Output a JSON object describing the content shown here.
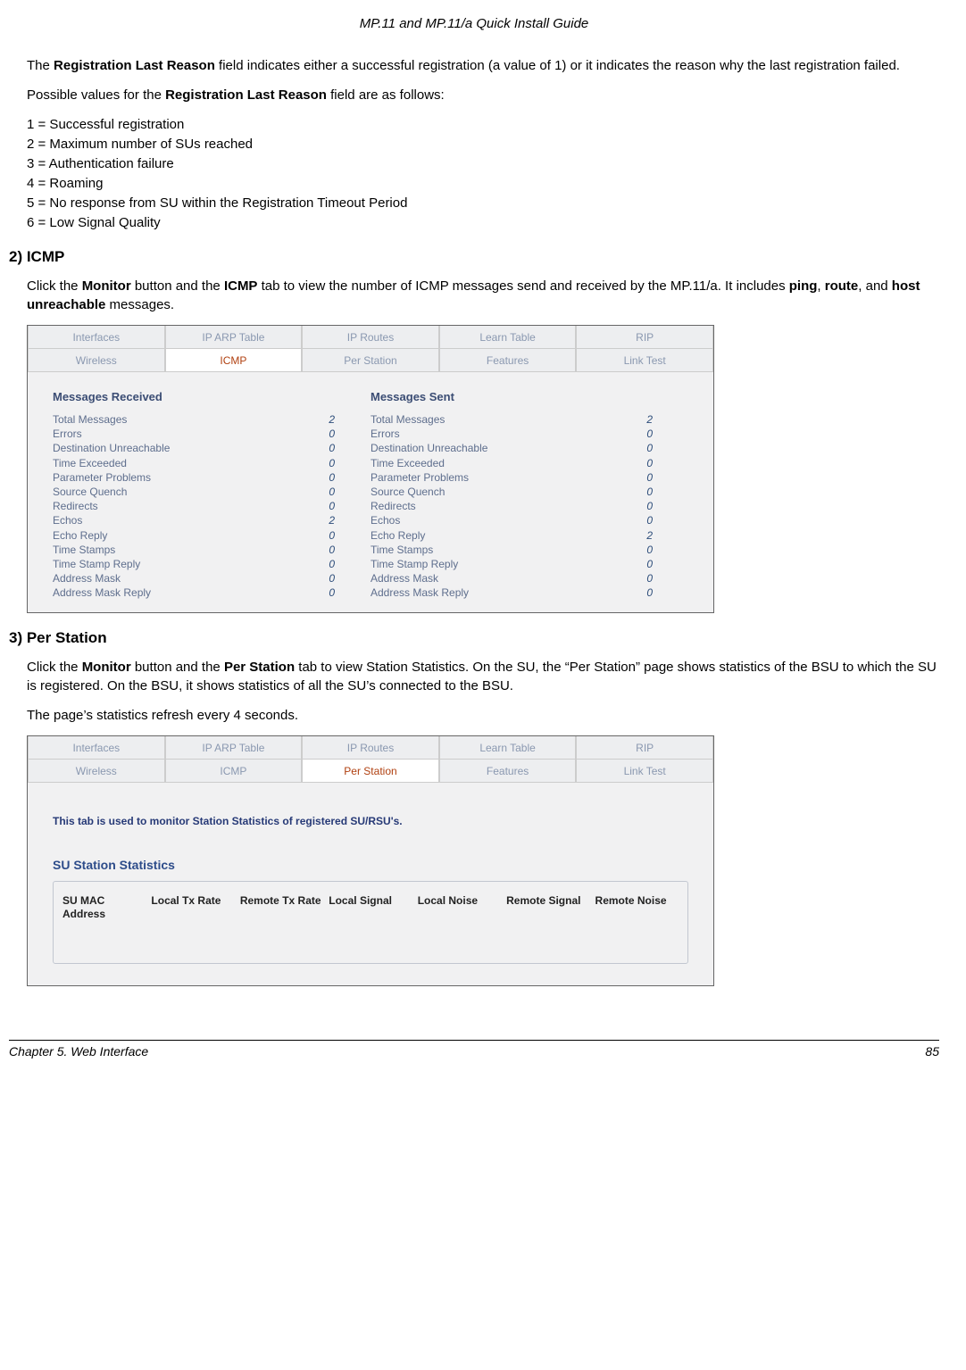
{
  "doc_header": "MP.11 and MP.11/a Quick Install Guide",
  "intro": {
    "p1_a": "The ",
    "p1_b": "Registration Last Reason",
    "p1_c": " field indicates either a successful registration (a value of 1) or it indicates the reason why the last registration failed.",
    "p2_a": "Possible values for the ",
    "p2_b": "Registration Last Reason",
    "p2_c": " field are as follows:"
  },
  "reasons": [
    "1 = Successful registration",
    "2 = Maximum number of SUs reached",
    "3 = Authentication failure",
    "4 = Roaming",
    "5 = No response from SU within the Registration Timeout Period",
    "6 = Low Signal Quality"
  ],
  "section2": {
    "title": "2) ICMP",
    "text_a": "Click the ",
    "text_b": "Monitor",
    "text_c": " button and the ",
    "text_d": "ICMP",
    "text_e": " tab to view the number of ICMP messages send and received by the MP.11/a.  It includes ",
    "text_f": "ping",
    "text_g": ", ",
    "text_h": "route",
    "text_i": ", and ",
    "text_j": "host unreachable",
    "text_k": " messages."
  },
  "panel1": {
    "tabs_row1": [
      "Interfaces",
      "IP ARP Table",
      "IP Routes",
      "Learn Table",
      "RIP"
    ],
    "tabs_row2": [
      "Wireless",
      "ICMP",
      "Per Station",
      "Features",
      "Link Test"
    ],
    "active": "ICMP",
    "col1_title": "Messages Received",
    "col2_title": "Messages Sent",
    "rows": [
      {
        "label": "Total Messages",
        "r": "2",
        "s": "2"
      },
      {
        "label": "Errors",
        "r": "0",
        "s": "0"
      },
      {
        "label": "Destination Unreachable",
        "r": "0",
        "s": "0"
      },
      {
        "label": "Time Exceeded",
        "r": "0",
        "s": "0"
      },
      {
        "label": "Parameter Problems",
        "r": "0",
        "s": "0"
      },
      {
        "label": "Source Quench",
        "r": "0",
        "s": "0"
      },
      {
        "label": "Redirects",
        "r": "0",
        "s": "0"
      },
      {
        "label": "Echos",
        "r": "2",
        "s": "0"
      },
      {
        "label": "Echo Reply",
        "r": "0",
        "s": "2"
      },
      {
        "label": "Time Stamps",
        "r": "0",
        "s": "0"
      },
      {
        "label": "Time Stamp Reply",
        "r": "0",
        "s": "0"
      },
      {
        "label": "Address Mask",
        "r": "0",
        "s": "0"
      },
      {
        "label": "Address Mask Reply",
        "r": "0",
        "s": "0"
      }
    ]
  },
  "section3": {
    "title": "3) Per Station",
    "p1_a": "Click the ",
    "p1_b": "Monitor",
    "p1_c": " button and the ",
    "p1_d": "Per Station",
    "p1_e": " tab to view Station Statistics. On the SU, the “Per Station” page shows statistics of the BSU to which the SU is registered. On the BSU, it shows statistics of all the SU’s connected to the BSU.",
    "p2": "The page’s statistics refresh every 4 seconds."
  },
  "panel2": {
    "tabs_row1": [
      "Interfaces",
      "IP ARP Table",
      "IP Routes",
      "Learn Table",
      "RIP"
    ],
    "tabs_row2": [
      "Wireless",
      "ICMP",
      "Per Station",
      "Features",
      "Link Test"
    ],
    "active": "Per Station",
    "info": "This tab is used to monitor Station Statistics of registered SU/RSU's.",
    "stat_title": "SU Station Statistics",
    "headers": [
      "SU MAC Address",
      "Local Tx Rate",
      "Remote Tx Rate",
      "Local Signal",
      "Local Noise",
      "Remote Signal",
      "Remote Noise"
    ]
  },
  "footer": {
    "left": "Chapter 5.  Web Interface",
    "right": "85"
  }
}
